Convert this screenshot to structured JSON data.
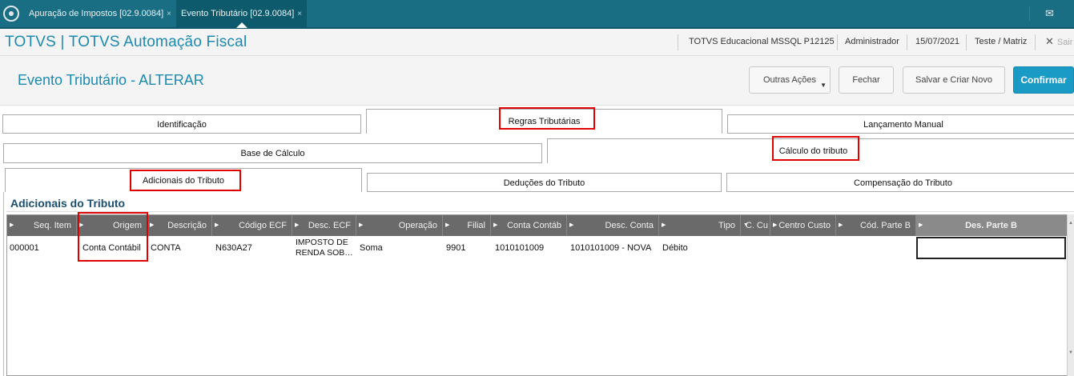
{
  "topbar": {
    "tabs": [
      {
        "label": "Apuração de Impostos [02.9.0084]",
        "close": "×"
      },
      {
        "label": "Evento Tributário [02.9.0084]",
        "close": "×"
      }
    ],
    "mail_icon": "mail-icon",
    "colors": {
      "bar": "#1a6e84"
    }
  },
  "header": {
    "app_title": "TOTVS | TOTVS Automação Fiscal",
    "environment": "TOTVS Educacional MSSQL P12125",
    "user": "Administrador",
    "date": "15/07/2021",
    "company": "Teste / Matriz",
    "exit_label": "Sair"
  },
  "form": {
    "title": "Evento Tributário - ALTERAR",
    "buttons": {
      "other_actions": "Outras Ações",
      "close": "Fechar",
      "save_new": "Salvar e Criar Novo",
      "confirm": "Confirmar"
    }
  },
  "tabs_level1": [
    "Identificação",
    "Regras Tributárias",
    "Lançamento Manual"
  ],
  "tabs_level2": [
    "Base de Cálculo",
    "Cálculo do tributo"
  ],
  "tabs_level3": [
    "Adicionais do Tributo",
    "Deduções do Tributo",
    "Compensação do Tributo"
  ],
  "section_title": "Adicionais do Tributo",
  "grid": {
    "columns": [
      "Seq. Item",
      "Origem",
      "Descrição",
      "Código ECF",
      "Desc. ECF",
      "Operação",
      "Filial",
      "Conta Contáb",
      "Desc. Conta",
      "Tipo",
      "C. Cu",
      "Centro Custo",
      "Cód. Parte B",
      "Des. Parte B"
    ],
    "rows": [
      {
        "seq": "000001",
        "origem": "Conta Contábil",
        "descricao": "CONTA",
        "codigo_ecf": "N630A27",
        "desc_ecf_1": "IMPOSTO DE",
        "desc_ecf_2": "RENDA SOB…",
        "operacao": "Soma",
        "filial": "9901",
        "conta": "1010101009",
        "desc_conta": "1010101009 - NOVA",
        "tipo": "Débito",
        "c_cu": "",
        "centro_custo": "",
        "cod_parte_b": "",
        "des_parte_b": ""
      }
    ]
  },
  "highlight_color": "#e00000",
  "accent_color": "#1a9bc6"
}
